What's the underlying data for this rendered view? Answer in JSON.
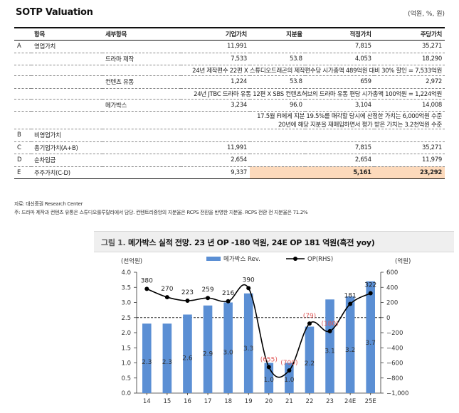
{
  "sotp": {
    "title": "SOTP Valuation",
    "unit": "(억원, %, 원)",
    "headers": [
      "항목",
      "세부항목",
      "기업가치",
      "지분율",
      "적정가치",
      "주당가치"
    ],
    "rows": {
      "a": {
        "id": "A",
        "item": "영업가치",
        "sub": "",
        "value": "11,991",
        "stake": "",
        "fair": "7,815",
        "per_share": "35,271"
      },
      "drama": {
        "id": "",
        "item": "",
        "sub": "드라마 제작",
        "value": "7,533",
        "stake": "53.8",
        "fair": "4,053",
        "per_share": "18,290"
      },
      "drama_note": "24년 제작편수 22편 X 스튜디오드래곤의 제작편수당 시가총액 489억원 대비 30% 할인 = 7,533억원",
      "content": {
        "id": "",
        "item": "",
        "sub": "컨텐츠 유통",
        "value": "1,224",
        "stake": "53.8",
        "fair": "659",
        "per_share": "2,972"
      },
      "content_note": "24년 JTBC 드라마 유통 12편 X SBS 컨텐츠허브의 드라마 유통 편당 시가총액 100억원 = 1,224억원",
      "megabox": {
        "id": "",
        "item": "",
        "sub": "메가박스",
        "value": "3,234",
        "stake": "96.0",
        "fair": "3,104",
        "per_share": "14,008"
      },
      "megabox_note1": "17.5월 FI에게 지분 19.5%를 매각할 당시에 산정한 가치는 6,000억원 수준",
      "megabox_note2": "20년에 해당 지분을 재매입하면서 평가 받은 가치는 3.2천억원 수준",
      "b": {
        "id": "B",
        "item": "비영업가치",
        "sub": "",
        "value": "",
        "stake": "",
        "fair": "",
        "per_share": ""
      },
      "c": {
        "id": "C",
        "item": "총기업가치(A+B)",
        "sub": "",
        "value": "11,991",
        "stake": "",
        "fair": "7,815",
        "per_share": "35,271"
      },
      "d": {
        "id": "D",
        "item": "순차입금",
        "sub": "",
        "value": "2,654",
        "stake": "",
        "fair": "2,654",
        "per_share": "11,979"
      },
      "e": {
        "id": "E",
        "item": "주주가치(C-D)",
        "sub": "",
        "value": "9,337",
        "stake": "",
        "fair": "5,161",
        "per_share": "23,292"
      }
    },
    "source": "자료: 대신증권 Research Center",
    "note": "주: 드라마 제작과 컨텐츠 유통은 스튜디오룰루랄라에서 담당. 컨텐트리중앙의 지분율은 RCPS 전환을 반영한 지분율. RCPS 전환 전 지분율은 71.2%"
  },
  "figure": {
    "label": "그림 1.",
    "title": "메가박스 실적 전망. 23 년 OP -180 억원, 24E OP 181 억원(흑전 yoy)"
  },
  "colors": {
    "bar": "#5b8fd4",
    "line": "#000000",
    "neg_label": "#e05a5a",
    "highlight": "#fcd9bb"
  },
  "chart_data": {
    "type": "bar",
    "categories": [
      "14",
      "15",
      "16",
      "17",
      "18",
      "19",
      "20",
      "21",
      "22",
      "23",
      "24E",
      "25E"
    ],
    "series": [
      {
        "name": "메가박스 Rev.",
        "axis": "left",
        "type": "bar",
        "values": [
          2.3,
          2.3,
          2.6,
          2.9,
          3.0,
          3.3,
          1.0,
          1.0,
          2.2,
          3.1,
          3.2,
          3.7
        ]
      },
      {
        "name": "OP(RHS)",
        "axis": "right",
        "type": "line",
        "values": [
          380,
          270,
          223,
          259,
          216,
          390,
          -655,
          -700,
          -79,
          -180,
          181,
          322
        ]
      }
    ],
    "bar_labels": [
      "2.3",
      "2.3",
      "2.6",
      "2.9",
      "3.0",
      "3.3",
      "1.0",
      "1.0",
      "2.2",
      "3.1",
      "3.2",
      "3.7"
    ],
    "line_labels": [
      "380",
      "270",
      "223",
      "259",
      "216",
      "390",
      "(655)",
      "(700)",
      "(79)",
      "(180)",
      "181",
      "322"
    ],
    "ylabel_left": "(천억원)",
    "ylabel_right": "(억원)",
    "ylim_left": [
      0,
      4.0
    ],
    "yticks_left": [
      "0.0",
      "0.5",
      "1.0",
      "1.5",
      "2.0",
      "2.5",
      "3.0",
      "3.5",
      "4.0"
    ],
    "ylim_right": [
      -1000,
      600
    ],
    "yticks_right": [
      "−1,000",
      "−800",
      "−600",
      "−400",
      "−200",
      "0",
      "200",
      "400",
      "600"
    ],
    "legend_position": "top",
    "grid": false
  }
}
